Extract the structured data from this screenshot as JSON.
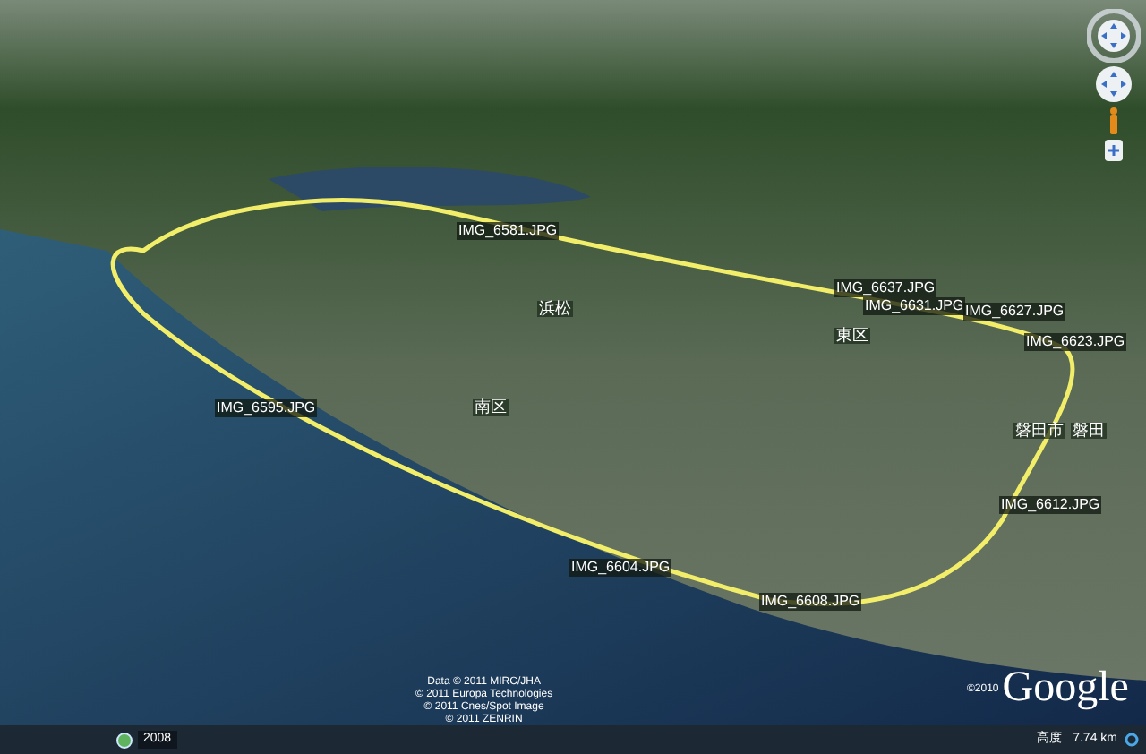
{
  "placemarks": [
    {
      "label": "IMG_6581.JPG"
    },
    {
      "label": "IMG_6637.JPG"
    },
    {
      "label": "IMG_6631.JPG"
    },
    {
      "label": "IMG_6627.JPG"
    },
    {
      "label": "IMG_6623.JPG"
    },
    {
      "label": "IMG_6595.JPG"
    },
    {
      "label": "IMG_6612.JPG"
    },
    {
      "label": "IMG_6604.JPG"
    },
    {
      "label": "IMG_6608.JPG"
    }
  ],
  "places": [
    "浜松",
    "東区",
    "南区",
    "磐田市",
    "磐田"
  ],
  "attribution": [
    "Data © 2011 MIRC/JHA",
    "© 2011 Europa Technologies",
    "© 2011 Cnes/Spot Image",
    "© 2011 ZENRIN"
  ],
  "logo": {
    "copyright": "©2010",
    "name": "Google"
  },
  "status_bar": {
    "year": "2008",
    "altitude_label": "高度",
    "altitude": "7.74 km"
  }
}
